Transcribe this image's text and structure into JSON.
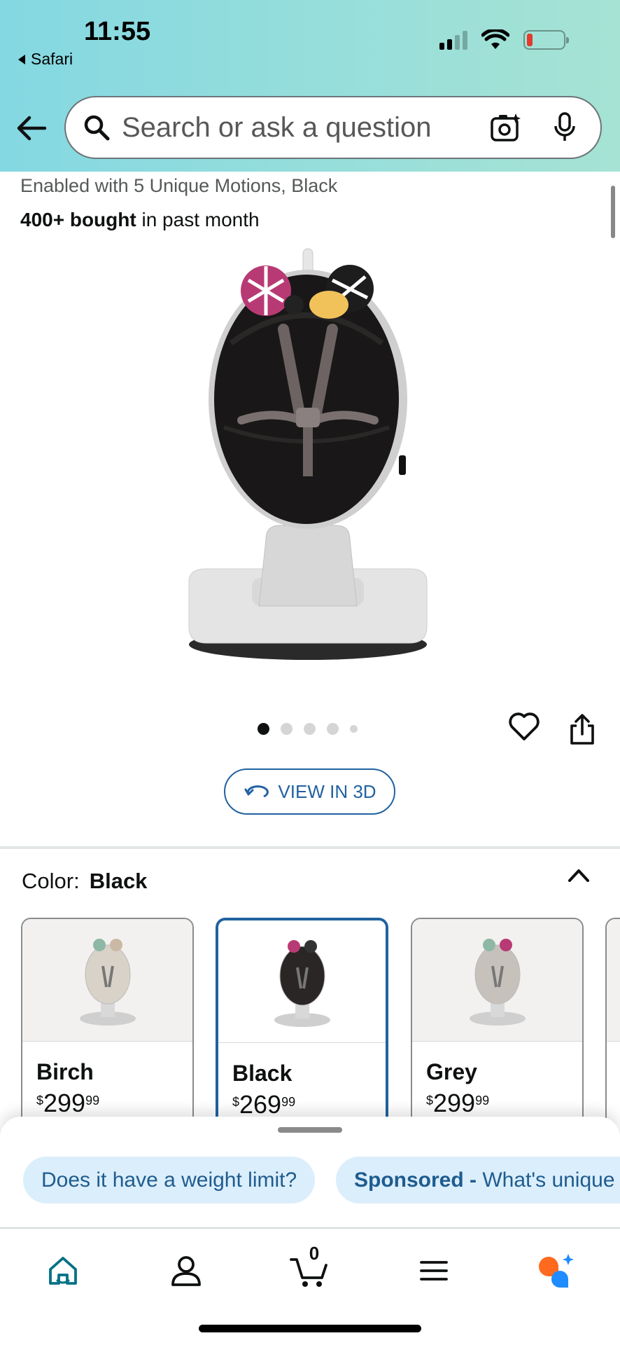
{
  "status_bar": {
    "time": "11:55",
    "back_app": "Safari"
  },
  "search": {
    "placeholder": "Search or ask a question"
  },
  "product": {
    "subtitle": "Enabled with 5 Unique Motions, Black",
    "bought_bold": "400+ bought",
    "bought_rest": " in past month",
    "image_count": 5,
    "active_image": 1,
    "view_3d_label": "VIEW IN 3D"
  },
  "color": {
    "label": "Color:",
    "selected": "Black",
    "options": [
      {
        "name": "Birch",
        "currency": "$",
        "whole": "299",
        "fraction": "99",
        "body_color": "#d9d2c8"
      },
      {
        "name": "Black",
        "currency": "$",
        "whole": "269",
        "fraction": "99",
        "body_color": "#2a2626"
      },
      {
        "name": "Grey",
        "currency": "$",
        "whole": "299",
        "fraction": "99",
        "body_color": "#c7c1bb"
      }
    ]
  },
  "suggestions": {
    "chip1": "Does it have a weight limit?",
    "chip2_bold": "Sponsored - ",
    "chip2_rest": "What's unique"
  },
  "nav": {
    "cart_count": "0",
    "items": [
      "home-icon",
      "account-icon",
      "cart-icon",
      "menu-icon",
      "rufus-ai-icon"
    ]
  },
  "colors": {
    "accent": "#2162a1",
    "teal_home": "#007185",
    "header_gradient": [
      "#84d8e2",
      "#a6e3d4"
    ]
  }
}
